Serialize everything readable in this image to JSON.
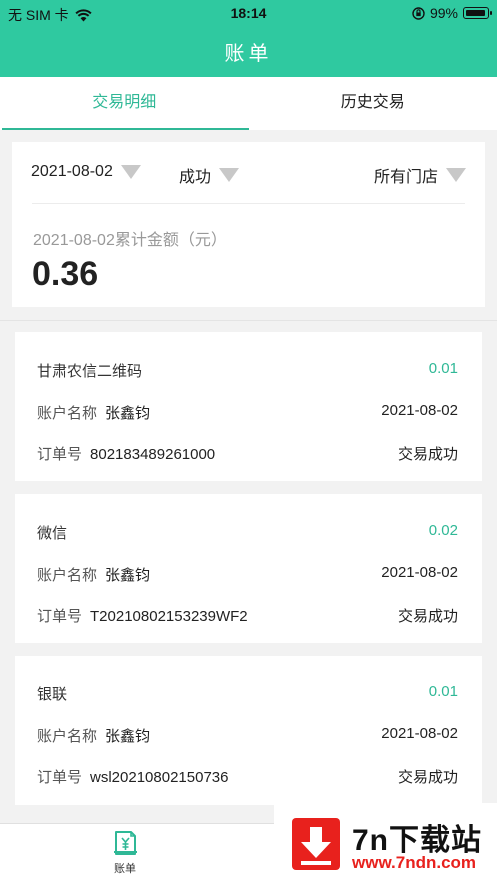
{
  "status_bar": {
    "carrier": "无 SIM 卡",
    "time": "18:14",
    "battery": "99%",
    "battery_level": 0.99
  },
  "nav": {
    "title": "账单"
  },
  "tabs": [
    {
      "label": "交易明细",
      "active": true
    },
    {
      "label": "历史交易",
      "active": false
    }
  ],
  "filters": {
    "date": "2021-08-02",
    "status": "成功",
    "store": "所有门店"
  },
  "summary": {
    "label": "2021-08-02累计金额（元）",
    "amount": "0.36"
  },
  "transactions": [
    {
      "channel": "甘肃农信二维码",
      "amount": "0.01",
      "account_label": "账户名称",
      "account_name": "张鑫钧",
      "date": "2021-08-02",
      "order_label": "订单号",
      "order_no": "802183489261000",
      "status": "交易成功"
    },
    {
      "channel": "微信",
      "amount": "0.02",
      "account_label": "账户名称",
      "account_name": "张鑫钧",
      "date": "2021-08-02",
      "order_label": "订单号",
      "order_no": "T20210802153239WF2",
      "status": "交易成功"
    },
    {
      "channel": "银联",
      "amount": "0.01",
      "account_label": "账户名称",
      "account_name": "张鑫钧",
      "date": "2021-08-02",
      "order_label": "订单号",
      "order_no": "wsl20210802150736",
      "status": "交易成功"
    }
  ],
  "bottom_nav": {
    "bill_label": "账单"
  },
  "watermark": {
    "title": "7n下载站",
    "url": "www.7ndn.com"
  },
  "colors": {
    "accent": "#2fc9a0",
    "accent_text": "#2fb896",
    "watermark_red": "#e8211d"
  }
}
